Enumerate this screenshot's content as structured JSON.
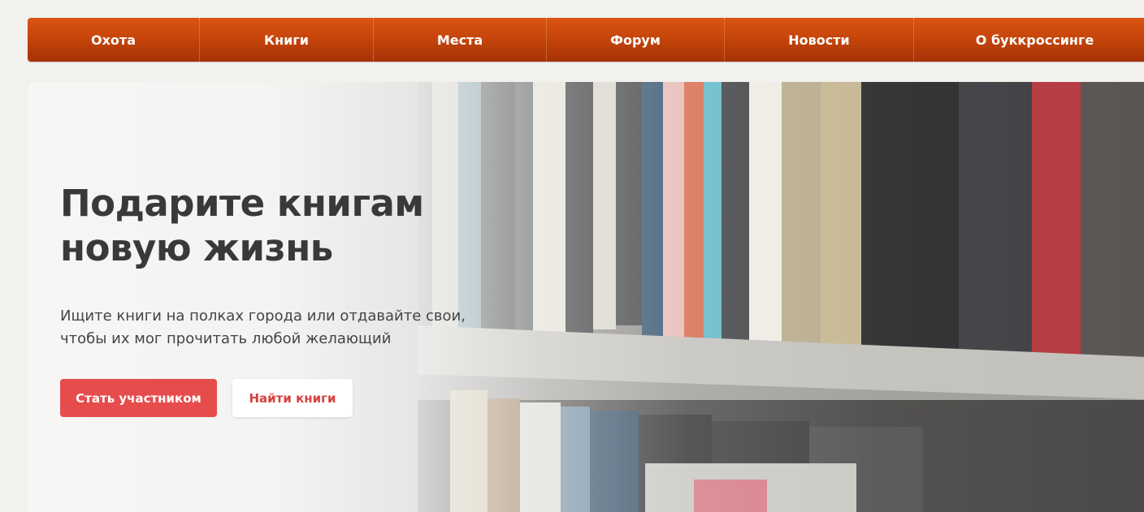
{
  "nav": {
    "items": [
      {
        "label": "Охота"
      },
      {
        "label": "Книги"
      },
      {
        "label": "Места"
      },
      {
        "label": "Форум"
      },
      {
        "label": "Новости"
      },
      {
        "label": "О буккроссинге"
      }
    ]
  },
  "hero": {
    "title_line1": "Подарите книгам",
    "title_line2": "новую жизнь",
    "subtitle_line1": "Ищите книги на полках города или отдавайте свои,",
    "subtitle_line2": "чтобы их мог прочитать любой желающий",
    "primary_button": "Стать участником",
    "secondary_button": "Найти книги"
  },
  "colors": {
    "nav_accent": "#c14209",
    "primary_button": "#e74c4c",
    "secondary_button_text": "#d4423f"
  }
}
